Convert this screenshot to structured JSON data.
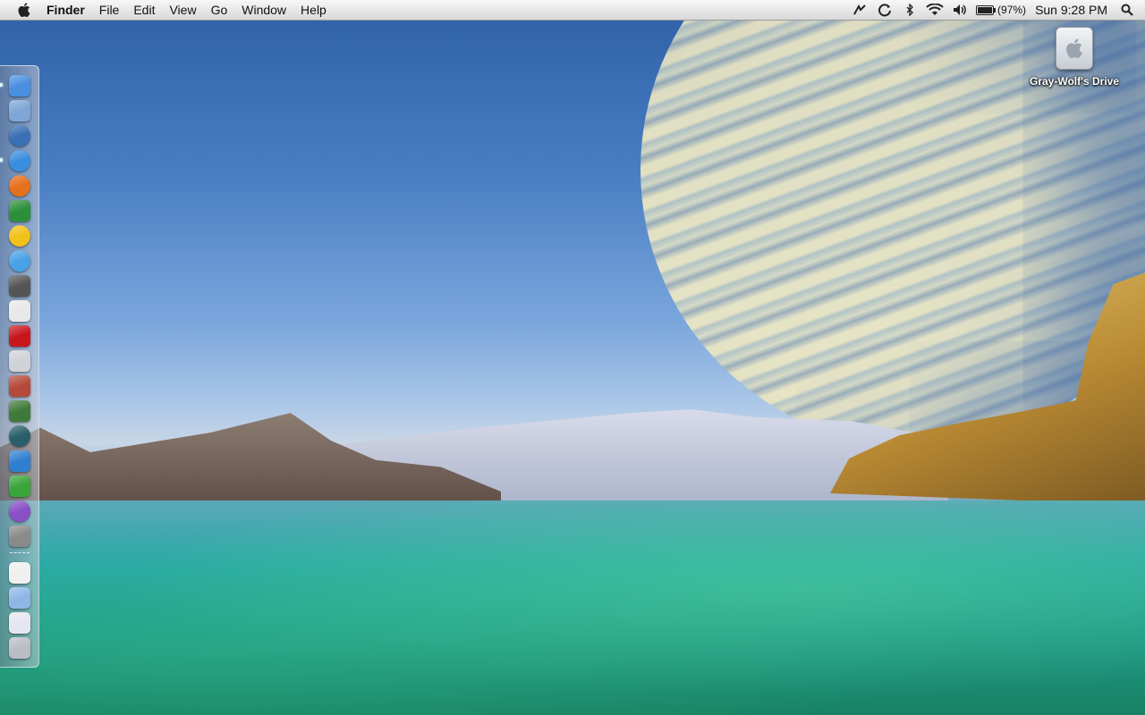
{
  "menubar": {
    "app_name": "Finder",
    "menus": [
      "File",
      "Edit",
      "View",
      "Go",
      "Window",
      "Help"
    ],
    "battery_text": "(97%)",
    "battery_level": 0.97,
    "clock": "Sun 9:28 PM",
    "status_icons": [
      "time-machine-icon",
      "sync-icon",
      "bluetooth-icon",
      "wifi-icon",
      "volume-icon",
      "battery-icon",
      "spotlight-icon"
    ]
  },
  "dock": {
    "items": [
      {
        "name": "finder",
        "running": true,
        "color": "#4a8fe0"
      },
      {
        "name": "preview",
        "running": false,
        "color": "#7ea6d6"
      },
      {
        "name": "thunderbird",
        "running": false,
        "color": "#3b6fb5"
      },
      {
        "name": "safari",
        "running": true,
        "color": "#3a8ee0"
      },
      {
        "name": "firefox",
        "running": false,
        "color": "#e5701c"
      },
      {
        "name": "photo-browser",
        "running": false,
        "color": "#2c8f3a"
      },
      {
        "name": "yahoo-messenger",
        "running": false,
        "color": "#f2c21a"
      },
      {
        "name": "itunes",
        "running": false,
        "color": "#4aa2e6"
      },
      {
        "name": "clock-app",
        "running": false,
        "color": "#555"
      },
      {
        "name": "ical",
        "running": false,
        "color": "#e8e8e8"
      },
      {
        "name": "photo-booth",
        "running": false,
        "color": "#c8161d"
      },
      {
        "name": "ipod-utility",
        "running": false,
        "color": "#cfd3d8"
      },
      {
        "name": "solitaire",
        "running": false,
        "color": "#b54a3a"
      },
      {
        "name": "chess",
        "running": false,
        "color": "#3f7a3a"
      },
      {
        "name": "time-machine",
        "running": false,
        "color": "#2a5e6a"
      },
      {
        "name": "cyberduck",
        "running": false,
        "color": "#2f7fd0"
      },
      {
        "name": "cricket-app",
        "running": false,
        "color": "#3aa53a"
      },
      {
        "name": "ie-browser",
        "running": false,
        "color": "#8a4fc6"
      },
      {
        "name": "system-preferences",
        "running": false,
        "color": "#8a8a8a"
      },
      {
        "name": "documents-stack",
        "running": false,
        "color": "#f0f0f0"
      },
      {
        "name": "applications-folder",
        "running": false,
        "color": "#8fb7e6"
      },
      {
        "name": "downloads-stack",
        "running": false,
        "color": "#e6e6f0"
      },
      {
        "name": "trash",
        "running": false,
        "color": "#b9bec5"
      }
    ],
    "separator_after": 18
  },
  "desktop": {
    "drive_label": "Gray-Wolf's Drive"
  }
}
